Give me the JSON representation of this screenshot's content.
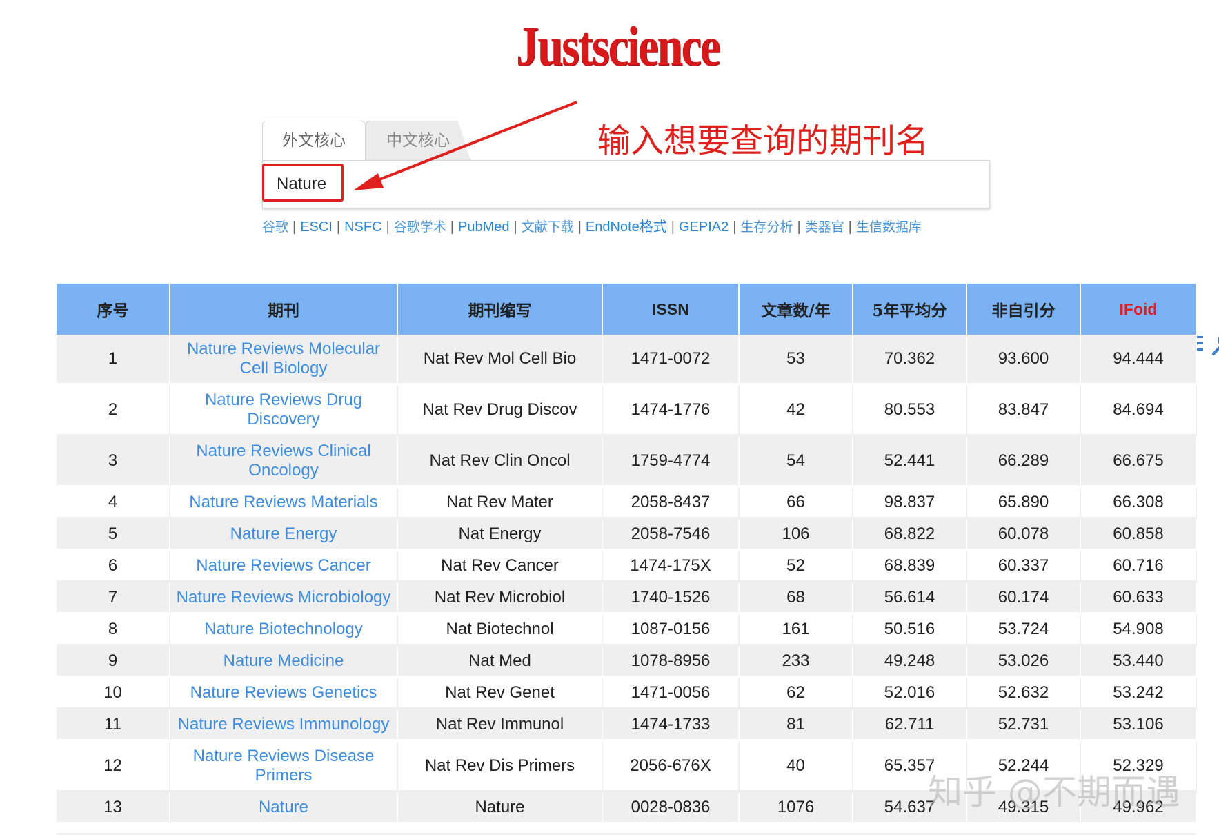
{
  "logo": "Justscience",
  "tabs": [
    {
      "label": "外文核心",
      "active": true
    },
    {
      "label": "中文核心",
      "active": false
    }
  ],
  "search": {
    "value": "Nature"
  },
  "icons": {
    "menu": "menu-icon",
    "search": "search-icon"
  },
  "annotation": "输入想要查询的期刊名",
  "links": [
    {
      "label": "谷歌",
      "cn": true
    },
    {
      "label": "ESCI",
      "cn": false
    },
    {
      "label": "NSFC",
      "cn": false
    },
    {
      "label": "谷歌学术",
      "cn": true
    },
    {
      "label": "PubMed",
      "cn": false
    },
    {
      "label": "文献下载",
      "cn": true
    },
    {
      "label": "EndNote格式",
      "cn": false
    },
    {
      "label": "GEPIA2",
      "cn": false
    },
    {
      "label": "生存分析",
      "cn": true
    },
    {
      "label": "类器官",
      "cn": true
    },
    {
      "label": "生信数据库",
      "cn": true
    }
  ],
  "table": {
    "headers": [
      "序号",
      "期刊",
      "期刊缩写",
      "ISSN",
      "文章数/年",
      "5年平均分",
      "非自引分",
      "IFoid"
    ],
    "rows": [
      {
        "no": "1",
        "journal": "Nature Reviews Molecular Cell Biology",
        "abbr": "Nat Rev Mol Cell Bio",
        "issn": "1471-0072",
        "articles": "53",
        "avg5": "70.362",
        "nonself": "93.600",
        "ifoid": "94.444"
      },
      {
        "no": "2",
        "journal": "Nature Reviews Drug Discovery",
        "abbr": "Nat Rev Drug Discov",
        "issn": "1474-1776",
        "articles": "42",
        "avg5": "80.553",
        "nonself": "83.847",
        "ifoid": "84.694"
      },
      {
        "no": "3",
        "journal": "Nature Reviews Clinical Oncology",
        "abbr": "Nat Rev Clin Oncol",
        "issn": "1759-4774",
        "articles": "54",
        "avg5": "52.441",
        "nonself": "66.289",
        "ifoid": "66.675"
      },
      {
        "no": "4",
        "journal": "Nature Reviews Materials",
        "abbr": "Nat Rev Mater",
        "issn": "2058-8437",
        "articles": "66",
        "avg5": "98.837",
        "nonself": "65.890",
        "ifoid": "66.308"
      },
      {
        "no": "5",
        "journal": "Nature Energy",
        "abbr": "Nat Energy",
        "issn": "2058-7546",
        "articles": "106",
        "avg5": "68.822",
        "nonself": "60.078",
        "ifoid": "60.858"
      },
      {
        "no": "6",
        "journal": "Nature Reviews Cancer",
        "abbr": "Nat Rev Cancer",
        "issn": "1474-175X",
        "articles": "52",
        "avg5": "68.839",
        "nonself": "60.337",
        "ifoid": "60.716"
      },
      {
        "no": "7",
        "journal": "Nature Reviews Microbiology",
        "abbr": "Nat Rev Microbiol",
        "issn": "1740-1526",
        "articles": "68",
        "avg5": "56.614",
        "nonself": "60.174",
        "ifoid": "60.633"
      },
      {
        "no": "8",
        "journal": "Nature Biotechnology",
        "abbr": "Nat Biotechnol",
        "issn": "1087-0156",
        "articles": "161",
        "avg5": "50.516",
        "nonself": "53.724",
        "ifoid": "54.908"
      },
      {
        "no": "9",
        "journal": "Nature Medicine",
        "abbr": "Nat Med",
        "issn": "1078-8956",
        "articles": "233",
        "avg5": "49.248",
        "nonself": "53.026",
        "ifoid": "53.440"
      },
      {
        "no": "10",
        "journal": "Nature Reviews Genetics",
        "abbr": "Nat Rev Genet",
        "issn": "1471-0056",
        "articles": "62",
        "avg5": "52.016",
        "nonself": "52.632",
        "ifoid": "53.242"
      },
      {
        "no": "11",
        "journal": "Nature Reviews Immunology",
        "abbr": "Nat Rev Immunol",
        "issn": "1474-1733",
        "articles": "81",
        "avg5": "62.711",
        "nonself": "52.731",
        "ifoid": "53.106"
      },
      {
        "no": "12",
        "journal": "Nature Reviews Disease Primers",
        "abbr": "Nat Rev Dis Primers",
        "issn": "2056-676X",
        "articles": "40",
        "avg5": "65.357",
        "nonself": "52.244",
        "ifoid": "52.329"
      },
      {
        "no": "13",
        "journal": "Nature",
        "abbr": "Nature",
        "issn": "0028-0836",
        "articles": "1076",
        "avg5": "54.637",
        "nonself": "49.315",
        "ifoid": "49.962"
      }
    ]
  },
  "watermark": "知乎 @不期而遇",
  "colors": {
    "header_bg": "#7ab2f4",
    "link": "#3e8ce0",
    "accent_red": "#e02020",
    "row_alt": "#efefef"
  }
}
